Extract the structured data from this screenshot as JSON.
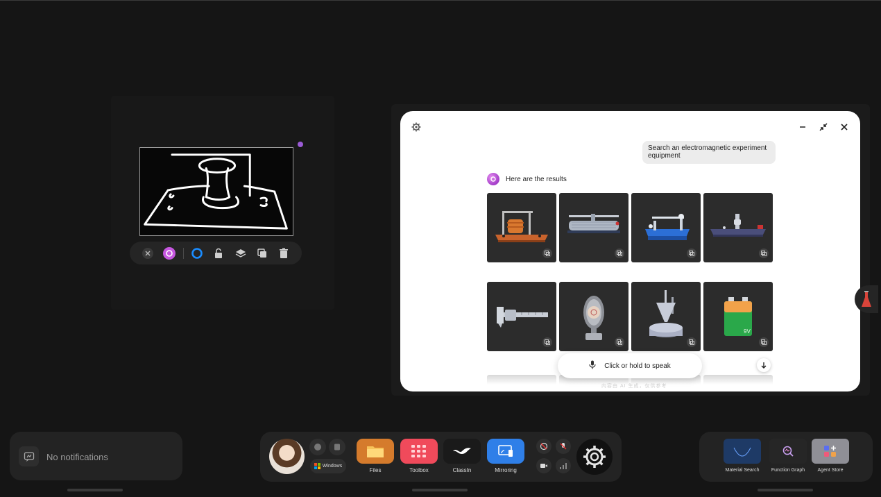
{
  "canvas": {
    "toolbar": {
      "items": [
        "close-icon",
        "ai-assistant-icon",
        "color-ring-icon",
        "unlock-icon",
        "layers-icon",
        "duplicate-icon",
        "delete-icon"
      ]
    }
  },
  "result_window": {
    "user_message": "Search an electromagnetic experiment equipment",
    "ai_message": "Here are the results",
    "results": [
      {
        "icon": "galvanometer-coil-apparatus"
      },
      {
        "icon": "rheostat-tube"
      },
      {
        "icon": "blue-rail-apparatus"
      },
      {
        "icon": "bench-apparatus"
      },
      {
        "icon": "vernier-caliper"
      },
      {
        "icon": "rotating-lamp"
      },
      {
        "icon": "funnel-stand"
      },
      {
        "icon": "battery-9v"
      }
    ],
    "speak_prompt": "Click or hold to speak",
    "faint_hint": "内容由 AI 生成，仅供参考"
  },
  "notifications": {
    "text": "No notifications"
  },
  "dock": {
    "windows_label": "Windows",
    "apps": [
      {
        "label": "Files",
        "color": "#e59a3a"
      },
      {
        "label": "Toolbox",
        "color": "#f04a5b"
      },
      {
        "label": "ClassIn",
        "color": "#1e1e1e"
      },
      {
        "label": "Mirroring",
        "color": "#2f7fe8"
      }
    ]
  },
  "tools": {
    "items": [
      {
        "label": "Material Search"
      },
      {
        "label": "Function Graph"
      },
      {
        "label": "Agent Store"
      }
    ]
  }
}
